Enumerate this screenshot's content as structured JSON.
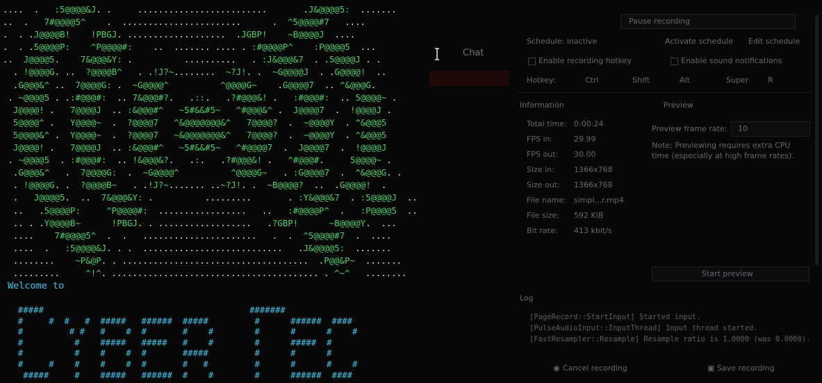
{
  "colors": {
    "terminal_bg": "#000000",
    "ascii_text": "#e7ecee",
    "ascii_accent": "#49d26a",
    "banner": "#3fc3ea",
    "background_text": "#8a8f94"
  },
  "terminal": {
    "ascii_art_lines": [
      "....  .   :5@@@@&J. .     .........................       .J&@@@@5:  .......",
      "..  .   7#@@@@5^    .  .......................      .  ^5@@@@#7   ....",
      ".  . .J@@@@B!    !PBGJ. ...................  .JGBP!    ~B@@@@J  ....",
      ".  . .5@@@@P:    ^P@@@@#:    ..  ....... .... . :#@@@@P^    :P@@@@5  ...",
      "..  J@@@@5.    7&@@@&Y: .          ..........   . :J&@@@&7  . .5@@@@J . .",
      "  . !@@@@G. ..  ?@@@@B^   . .!J?~........  ~?J!. .  ~G@@@@J  . .G@@@@!  ..",
      "  .G@@@&^ ..  7@@@@G: .  ~G@@@@^          ^@@@@G~    .G@@@@7  .. ^&@@@G.",
      " . ~@@@@5 . .:#@@@#:  .. 7&@@@#?.   .::.   .?#@@@&! .   :#@@@#:  .. 5@@@@~ .",
      "  J@@@@! .   7@@@@J  .. :&@@@#^   ~5#&&#5~   ^#@@@&^ .  J@@@@7  .  !@@@@J .",
      "  5@@@@^ .   Y@@@@~  .  ?@@@@7   ^&@@@@@@@&^   7@@@@?  .  ~@@@@Y  . ^&@@@5",
      "  5@@@@&^ .  Y@@@@~  .  ?@@@@7   ~&@@@@@@@&^   7@@@@?  .  ~@@@@Y  . ^&@@@5",
      "  J@@@@! .   7@@@@J  .. :&@@@#^   ~5#&&#5~   ^#@@@@7  .  J@@@@7  .  !@@@@J",
      " . ~@@@@5  . :#@@@#:  .. !&@@@&?.   .:.   .?#@@@&! .   ^#@@@#.     5@@@@~ .",
      "  .G@@@&^   .  7@@@@G:  .  ~G@@@@^          ^@@@@G~   . :G@@@@7  .  ^&@@@G. .",
      "  . !@@@@G. .  ?@@@@B~   . .!J?~....... ..~?J!. .  ~B@@@@?  ..  .G@@@@!  .",
      "  .   J@@@@5.  ..  7&@@@&Y: .          .........       . :Y&@@@&7  . :5@@@@J  ..",
      "  ..   .5@@@@P:     ^P@@@@#:  .................   ..   :#@@@@P^  .   :P@@@@5  ..",
      "  .. . .Y@@@@B~      !PBGJ. . ..................   .?GBP!      ~B@@@@Y.  ...",
      "  ....    7#@@@@5^  .  .   ......................   .  .  ^5@@@@#7  .  ....",
      "  ....  .   :5@@@@&J. . .  ...........................   .J&@@@@5:  .......",
      "  ........    ~P&@P. . ....................................  .P@@&P~  .......",
      "  .........     ^!^. ........................................ . ^~^   ........"
    ],
    "welcome_text": "Welcome to",
    "banner_lines": [
      "  #####                                        #######",
      "  #     #  #   #  #####   ######  #####         #      ######  ####",
      "  #         # #   #    #  #       #    #        #      #      #    #",
      "  #          #    #####   #####   #    #        #      #####  #",
      "  #          #    #    #  #       #####         #      #      #",
      "  #     #    #    #    #  #       #   #         #      #      #    #",
      "   #####     #    #####   ######  #    #        #      ######  ####"
    ]
  },
  "background_window": {
    "top_button": "Pause recording",
    "schedule_label": "Schedule: inactive",
    "activate_schedule": "Activate schedule",
    "edit_schedule": "Edit schedule",
    "enable_hotkey": "Enable recording hotkey",
    "enable_sound": "Enable sound notifications",
    "hotkey_label": "Hotkey:",
    "hotkey_keys": [
      "Ctrl",
      "Shift",
      "Alt",
      "Super",
      "R"
    ],
    "information_heading": "Information",
    "preview_heading": "Preview",
    "info_rows": [
      {
        "label": "Total time:",
        "value": "0:00:24"
      },
      {
        "label": "FPS in:",
        "value": "29.99"
      },
      {
        "label": "FPS out:",
        "value": "30.00"
      },
      {
        "label": "Size in:",
        "value": "1366x768"
      },
      {
        "label": "Size out:",
        "value": "1366x768"
      },
      {
        "label": "File name:",
        "value": "simpl...r.mp4"
      },
      {
        "label": "File size:",
        "value": "592 KiB"
      },
      {
        "label": "Bit rate:",
        "value": "413 kbit/s"
      }
    ],
    "preview_frame_rate_label": "Preview frame rate:",
    "preview_frame_rate_value": "10",
    "preview_note": "Note: Previewing requires extra CPU time (especially at high frame rates).",
    "start_preview": "Start preview",
    "log_heading": "Log",
    "log_lines": [
      "[PageRecord::StartInput] Started input.",
      "[PulseAudioInput::InputThread] Input thread started.",
      "[FastResampler::Resample] Resample ratio is 1.0000 (was 0.0000)."
    ],
    "cancel_recording": "Cancel recording",
    "save_recording": "Save recording",
    "chat_label": "Chat"
  }
}
